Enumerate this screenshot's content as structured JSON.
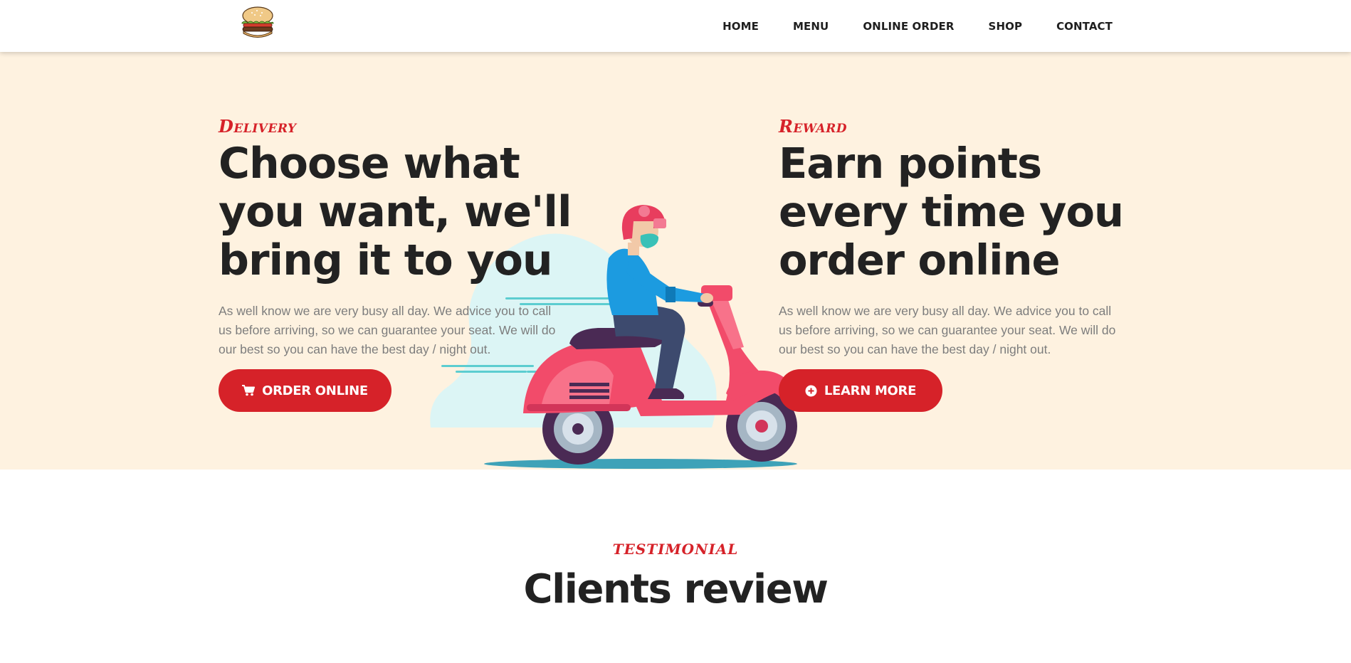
{
  "header": {
    "logo_icon": "burger-logo-icon",
    "nav": [
      {
        "label": "HOME"
      },
      {
        "label": "MENU"
      },
      {
        "label": "ONLINE ORDER"
      },
      {
        "label": "SHOP"
      },
      {
        "label": "CONTACT"
      }
    ]
  },
  "hero": {
    "illustration_icon": "delivery-scooter-illustration",
    "delivery": {
      "kicker": "Delivery",
      "headline_line1": "Choose what",
      "headline_line2": "you want, we'll",
      "headline_line3": "bring it to you",
      "description": "As well know we are very busy all day. We advice you to call us before arriving, so we can guarantee your seat. We will do our best so you can have the best day / night out.",
      "button_label": "ORDER ONLINE",
      "button_icon": "cart-icon"
    },
    "reward": {
      "kicker": "Reward",
      "headline_line1": "Earn points",
      "headline_line2": "every time you",
      "headline_line3": "order online",
      "description": "As well know we are very busy all day. We advice you to call us before arriving, so we can guarantee your seat. We will do our best so you can have the best day / night out.",
      "button_label": "LEARN MORE",
      "button_icon": "plus-circle-icon"
    }
  },
  "testimonial": {
    "kicker": "TESTIMONIAL",
    "title": "Clients review"
  },
  "colors": {
    "accent": "#d62229",
    "hero_background": "#fef2e0",
    "heading": "#222222",
    "body_text": "#7d7d7d"
  }
}
